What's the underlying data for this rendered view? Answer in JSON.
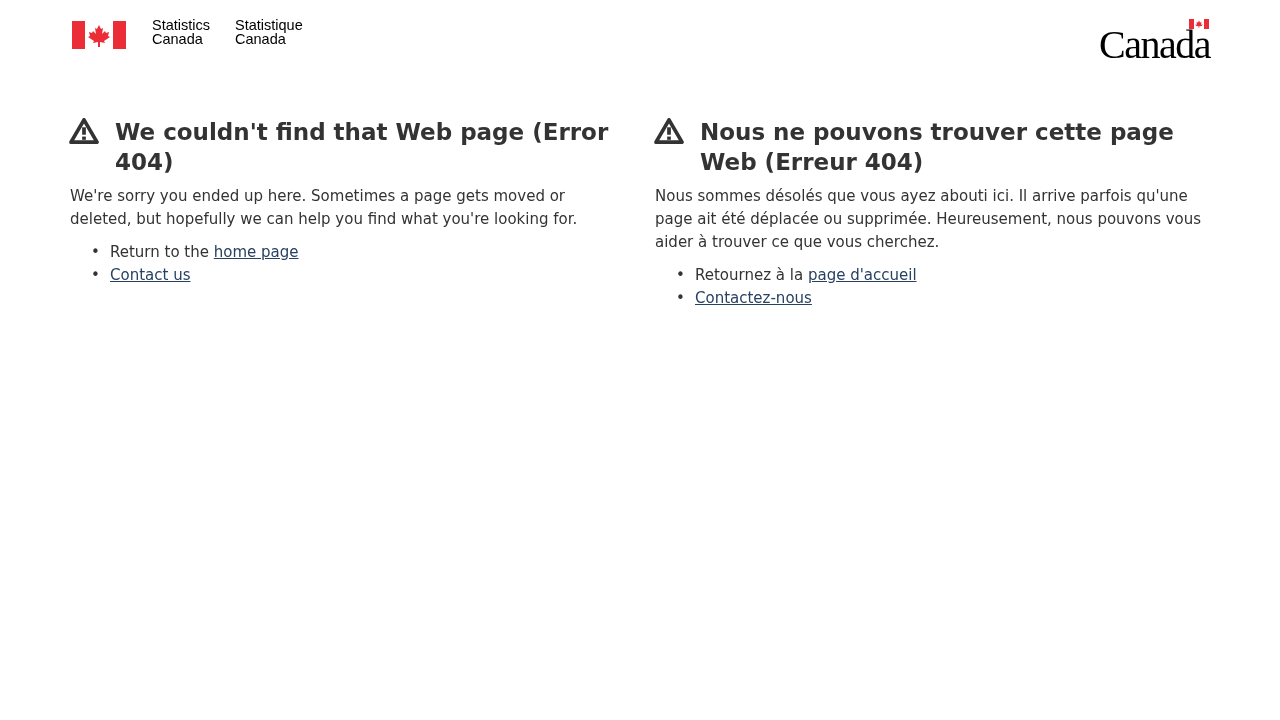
{
  "header": {
    "agency_en": "Statistics\nCanada",
    "agency_fr": "Statistique\nCanada",
    "wordmark": "Canada"
  },
  "sections": [
    {
      "heading": "We couldn't find that Web page (Error 404)",
      "paragraph": "We're sorry you ended up here. Sometimes a page gets moved or deleted, but hopefully we can help you find what you're looking for.",
      "items": [
        {
          "bullet": "•",
          "text": "Return to the ",
          "link": "home page"
        },
        {
          "bullet": "•",
          "link": "Contact us"
        }
      ]
    },
    {
      "heading": "Nous ne pouvons trouver cette page Web (Erreur 404)",
      "paragraph": "Nous sommes désolés que vous ayez abouti ici. Il arrive parfois qu'une page ait été déplacée ou supprimée. Heureusement, nous pouvons vous aider à trouver ce que vous cherchez.",
      "items": [
        {
          "bullet": "•",
          "text": "Retournez à la ",
          "link": "page d'accueil"
        },
        {
          "bullet": "•",
          "link": "Contactez-nous"
        }
      ]
    }
  ]
}
